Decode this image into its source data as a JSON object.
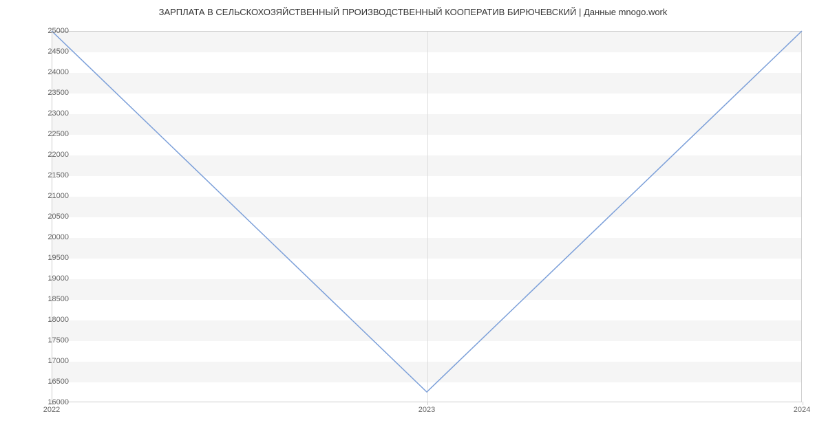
{
  "chart_data": {
    "type": "line",
    "title": "ЗАРПЛАТА В СЕЛЬСКОХОЗЯЙСТВЕННЫЙ ПРОИЗВОДСТВЕННЫЙ КООПЕРАТИВ БИРЮЧЕВСКИЙ | Данные mnogo.work",
    "xlabel": "",
    "ylabel": "",
    "x": [
      2022,
      2023,
      2024
    ],
    "values": [
      25000,
      16250,
      25000
    ],
    "x_ticks": [
      2022,
      2023,
      2024
    ],
    "y_ticks": [
      16000,
      16500,
      17000,
      17500,
      18000,
      18500,
      19000,
      19500,
      20000,
      20500,
      21000,
      21500,
      22000,
      22500,
      23000,
      23500,
      24000,
      24500,
      25000
    ],
    "xlim": [
      2022,
      2024
    ],
    "ylim": [
      16000,
      25000
    ]
  }
}
